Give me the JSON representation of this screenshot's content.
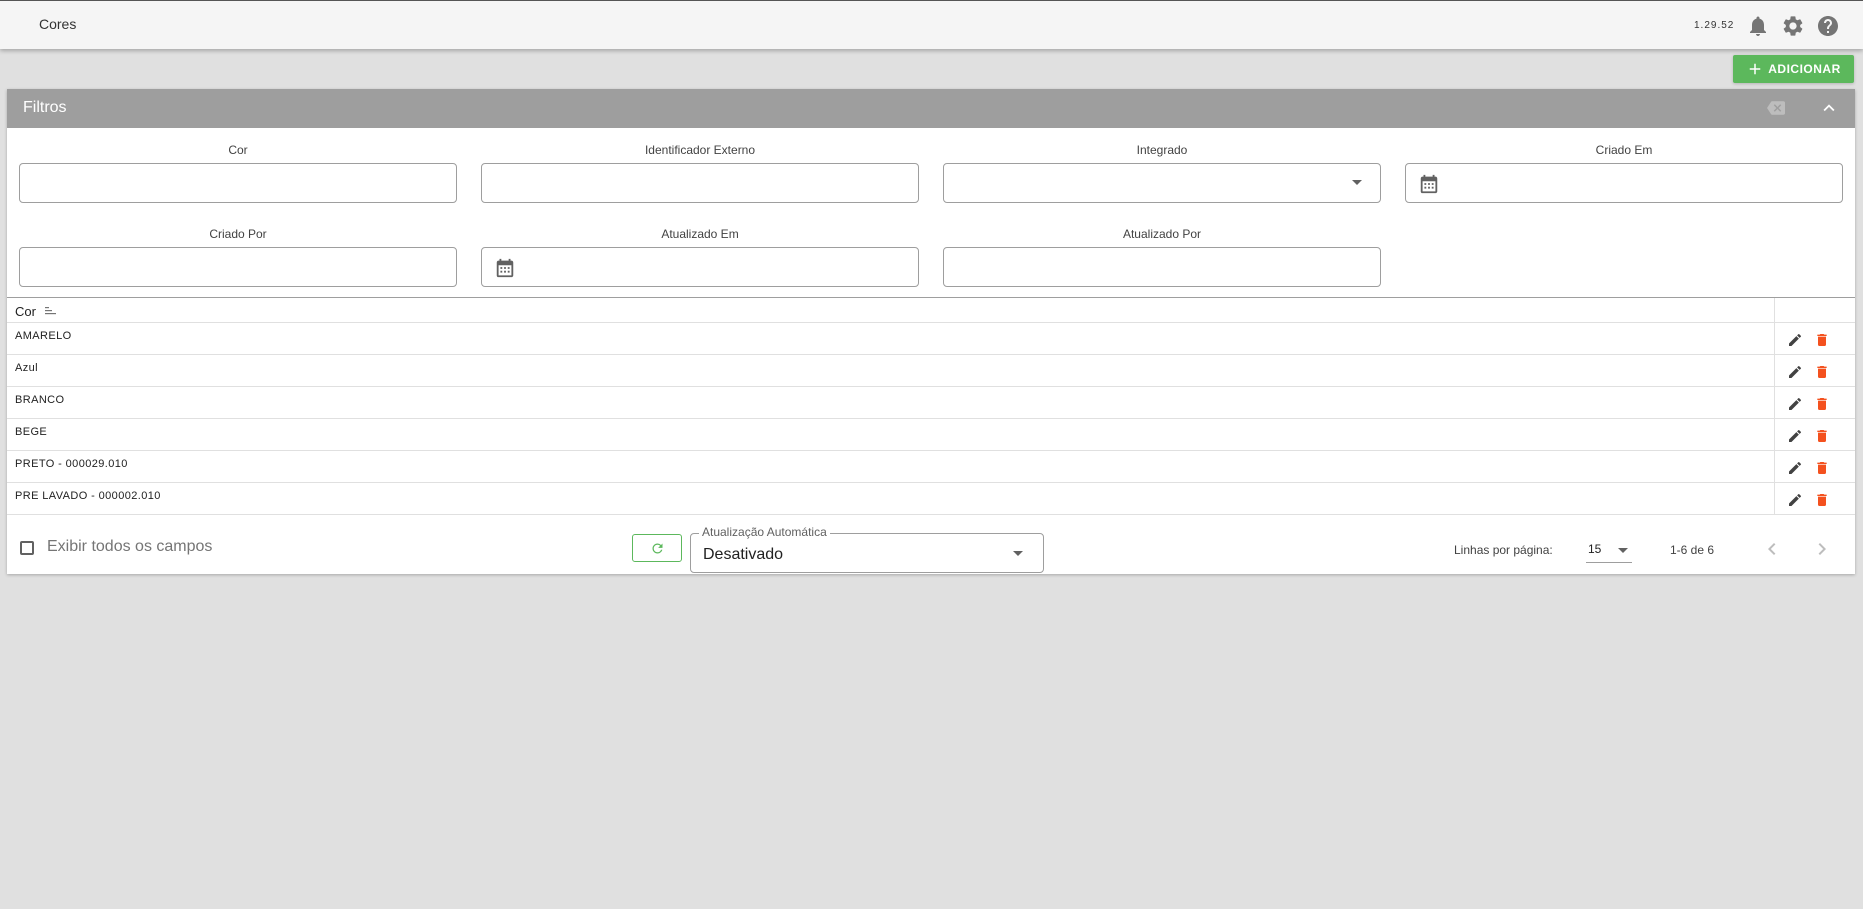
{
  "header": {
    "title": "Cores",
    "version": "1.29.52"
  },
  "toolbar": {
    "add_label": "ADICIONAR"
  },
  "filters": {
    "title": "Filtros",
    "fields": {
      "cor": {
        "label": "Cor",
        "value": ""
      },
      "identificador_externo": {
        "label": "Identificador Externo",
        "value": ""
      },
      "integrado": {
        "label": "Integrado",
        "value": ""
      },
      "criado_em": {
        "label": "Criado Em",
        "value": ""
      },
      "criado_por": {
        "label": "Criado Por",
        "value": ""
      },
      "atualizado_em": {
        "label": "Atualizado Em",
        "value": ""
      },
      "atualizado_por": {
        "label": "Atualizado Por",
        "value": ""
      }
    }
  },
  "table": {
    "columns": [
      "Cor"
    ],
    "rows": [
      {
        "cor": "AMARELO"
      },
      {
        "cor": "Azul"
      },
      {
        "cor": "BRANCO"
      },
      {
        "cor": "BEGE"
      },
      {
        "cor": "PRETO - 000029.010"
      },
      {
        "cor": "PRE LAVADO - 000002.010"
      }
    ]
  },
  "footer": {
    "show_all_label": "Exibir todos os campos",
    "auto_update_label": "Atualização Automática",
    "auto_update_value": "Desativado",
    "rows_per_page_label": "Linhas por página:",
    "rows_per_page_value": "15",
    "range_text": "1-6 de 6"
  },
  "icons": {
    "notifications": "bell-icon",
    "settings": "gear-icon",
    "help": "help-icon",
    "add": "plus-icon",
    "clear_filters": "backspace-icon",
    "collapse": "chevron-up-icon",
    "date": "calendar-icon",
    "sort": "sort-icon",
    "edit": "pencil-icon",
    "delete": "trash-icon",
    "refresh": "refresh-icon",
    "prev": "chevron-left-icon",
    "next": "chevron-right-icon"
  },
  "colors": {
    "accent": "#5cb85c",
    "header_bg": "#9e9e9e",
    "delete": "#f4511e",
    "background": "#e0e0e0"
  }
}
